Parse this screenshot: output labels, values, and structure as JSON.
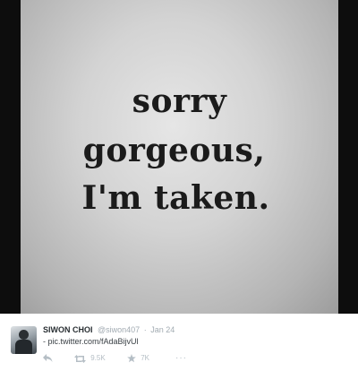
{
  "photo": {
    "line1": "sorry",
    "line2": "gorgeous,",
    "line3": "I'm taken."
  },
  "tweet": {
    "author_name": "SIWON CHOI",
    "handle": "@siwon407",
    "separator": "·",
    "date": "Jan 24",
    "text": "- pic.twitter.com/fAdaBijvUl",
    "retweet_count": "9.5K",
    "favorite_count": "7K",
    "more_label": "···"
  },
  "icons": {
    "reply": "reply-icon",
    "retweet": "retweet-icon",
    "favorite": "star-icon",
    "more": "more-dots-icon"
  },
  "colors": {
    "name": "#292f33",
    "meta": "#a2abb2",
    "action": "#b5bec5"
  }
}
